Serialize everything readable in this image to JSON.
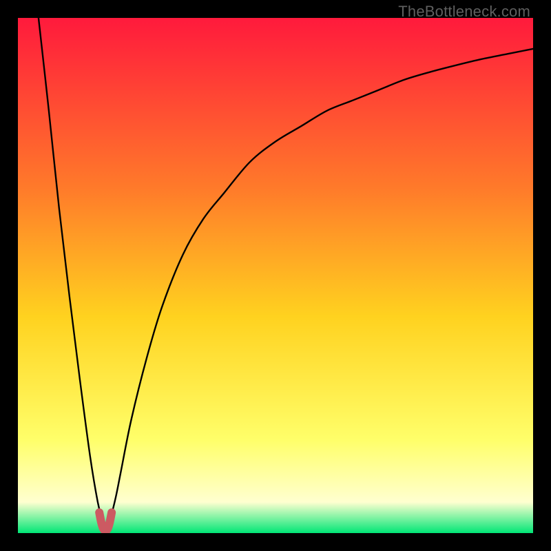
{
  "watermark": "TheBottleneck.com",
  "colors": {
    "frame": "#000000",
    "grad_top": "#ff1a3c",
    "grad_mid_upper": "#ff7a2a",
    "grad_mid": "#ffd21f",
    "grad_lower": "#ffff6a",
    "grad_light": "#ffffd0",
    "grad_bottom": "#00e676",
    "curve": "#000000",
    "marker": "#cc5a62"
  },
  "chart_data": {
    "type": "line",
    "title": "",
    "xlabel": "",
    "ylabel": "",
    "xlim": [
      0,
      100
    ],
    "ylim": [
      0,
      100
    ],
    "grid": false,
    "legend": false,
    "minimum_x": 17,
    "series": [
      {
        "name": "left-branch",
        "x": [
          4,
          6,
          8,
          10,
          12,
          14,
          15.5,
          16.5,
          17
        ],
        "y": [
          100,
          82,
          63,
          46,
          30,
          15,
          6,
          2,
          0
        ]
      },
      {
        "name": "right-branch",
        "x": [
          17,
          18,
          19,
          20,
          22,
          25,
          28,
          32,
          36,
          40,
          45,
          50,
          55,
          60,
          65,
          70,
          75,
          80,
          85,
          90,
          95,
          100
        ],
        "y": [
          0,
          3,
          7,
          12,
          22,
          34,
          44,
          54,
          61,
          66,
          72,
          76,
          79,
          82,
          84,
          86,
          88,
          89.5,
          90.8,
          92,
          93,
          94
        ]
      },
      {
        "name": "optimum-marker",
        "x": [
          15.8,
          16.2,
          16.6,
          17.0,
          17.4,
          17.8,
          18.2
        ],
        "y": [
          4.0,
          2.0,
          0.8,
          0.5,
          0.8,
          2.0,
          4.0
        ]
      }
    ]
  }
}
